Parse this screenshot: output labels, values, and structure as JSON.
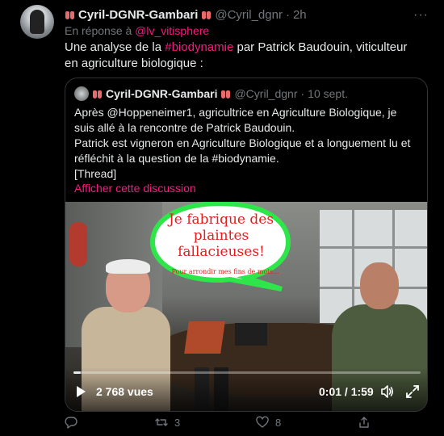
{
  "tweet": {
    "author_name": "Cyril-DGNR-Gambari",
    "author_handle": "@Cyril_dgnr",
    "dot": "·",
    "time": "2h",
    "more_label": "···",
    "reply_prefix": "En réponse à",
    "reply_mention": "@lv_vitisphere",
    "text_before": "Une analyse de la ",
    "hashtag": "#biodynamie",
    "text_after": " par Patrick Baudouin, viticulteur en agriculture biologique :"
  },
  "quote": {
    "author_name": "Cyril-DGNR-Gambari",
    "author_handle": "@Cyril_dgnr",
    "dot": "·",
    "time": "10 sept.",
    "text_line1": "Après @Hoppeneimer1, agricultrice en Agriculture Biologique, je suis allé à la rencontre de Patrick Baudouin.",
    "text_line2": "Patrick est vigneron en Agriculture Biologique et a longuement lu et réfléchit à la question de la #biodynamie.",
    "text_line3": "[Thread]",
    "show_label": "Afficher cette discussion"
  },
  "video": {
    "bubble_text": "Je fabrique des plaintes fallacieuses!",
    "bubble_sub": "Pour arrondir mes fins de mois...",
    "views": "2 768 vues",
    "time": "0:01 / 1:59",
    "progress_fraction": 0.01
  },
  "actions": {
    "reply_count": "",
    "retweet_count": "3",
    "like_count": "8",
    "share_count": ""
  },
  "colors": {
    "accent": "#f91880",
    "muted": "#71767b",
    "text": "#e7e9ea",
    "bubble_fill": "#2ee64a"
  }
}
